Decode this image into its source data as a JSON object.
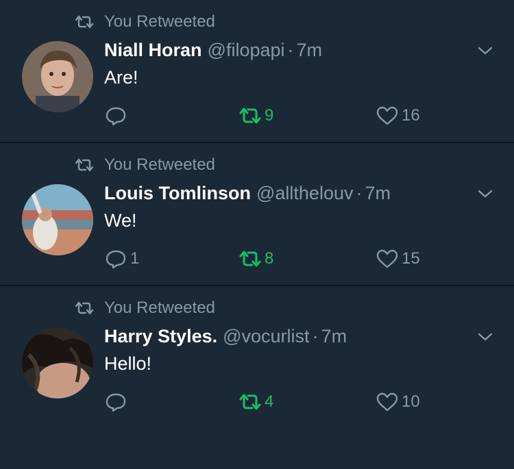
{
  "tweets": [
    {
      "retweet_label": "You Retweeted",
      "name": "Niall Horan",
      "handle": "@filopapi",
      "dot": "·",
      "time": "7m",
      "text": "Are!",
      "replies": "",
      "retweets": "9",
      "likes": "16"
    },
    {
      "retweet_label": "You Retweeted",
      "name": "Louis Tomlinson",
      "handle": "@allthelouv",
      "dot": "·",
      "time": "7m",
      "text": "We!",
      "replies": "1",
      "retweets": "8",
      "likes": "15"
    },
    {
      "retweet_label": "You Retweeted",
      "name": "Harry Styles.",
      "handle": "@vocurlist",
      "dot": "·",
      "time": "7m",
      "text": "Hello!",
      "replies": "",
      "retweets": "4",
      "likes": "10"
    }
  ],
  "colors": {
    "background": "#1b2836",
    "muted": "#8899a6",
    "retweet_green": "#17bf63",
    "divider": "#0f161e"
  },
  "icons": {
    "retweet": "retweet-icon",
    "reply": "reply-icon",
    "like": "heart-icon",
    "menu": "chevron-down-icon"
  }
}
